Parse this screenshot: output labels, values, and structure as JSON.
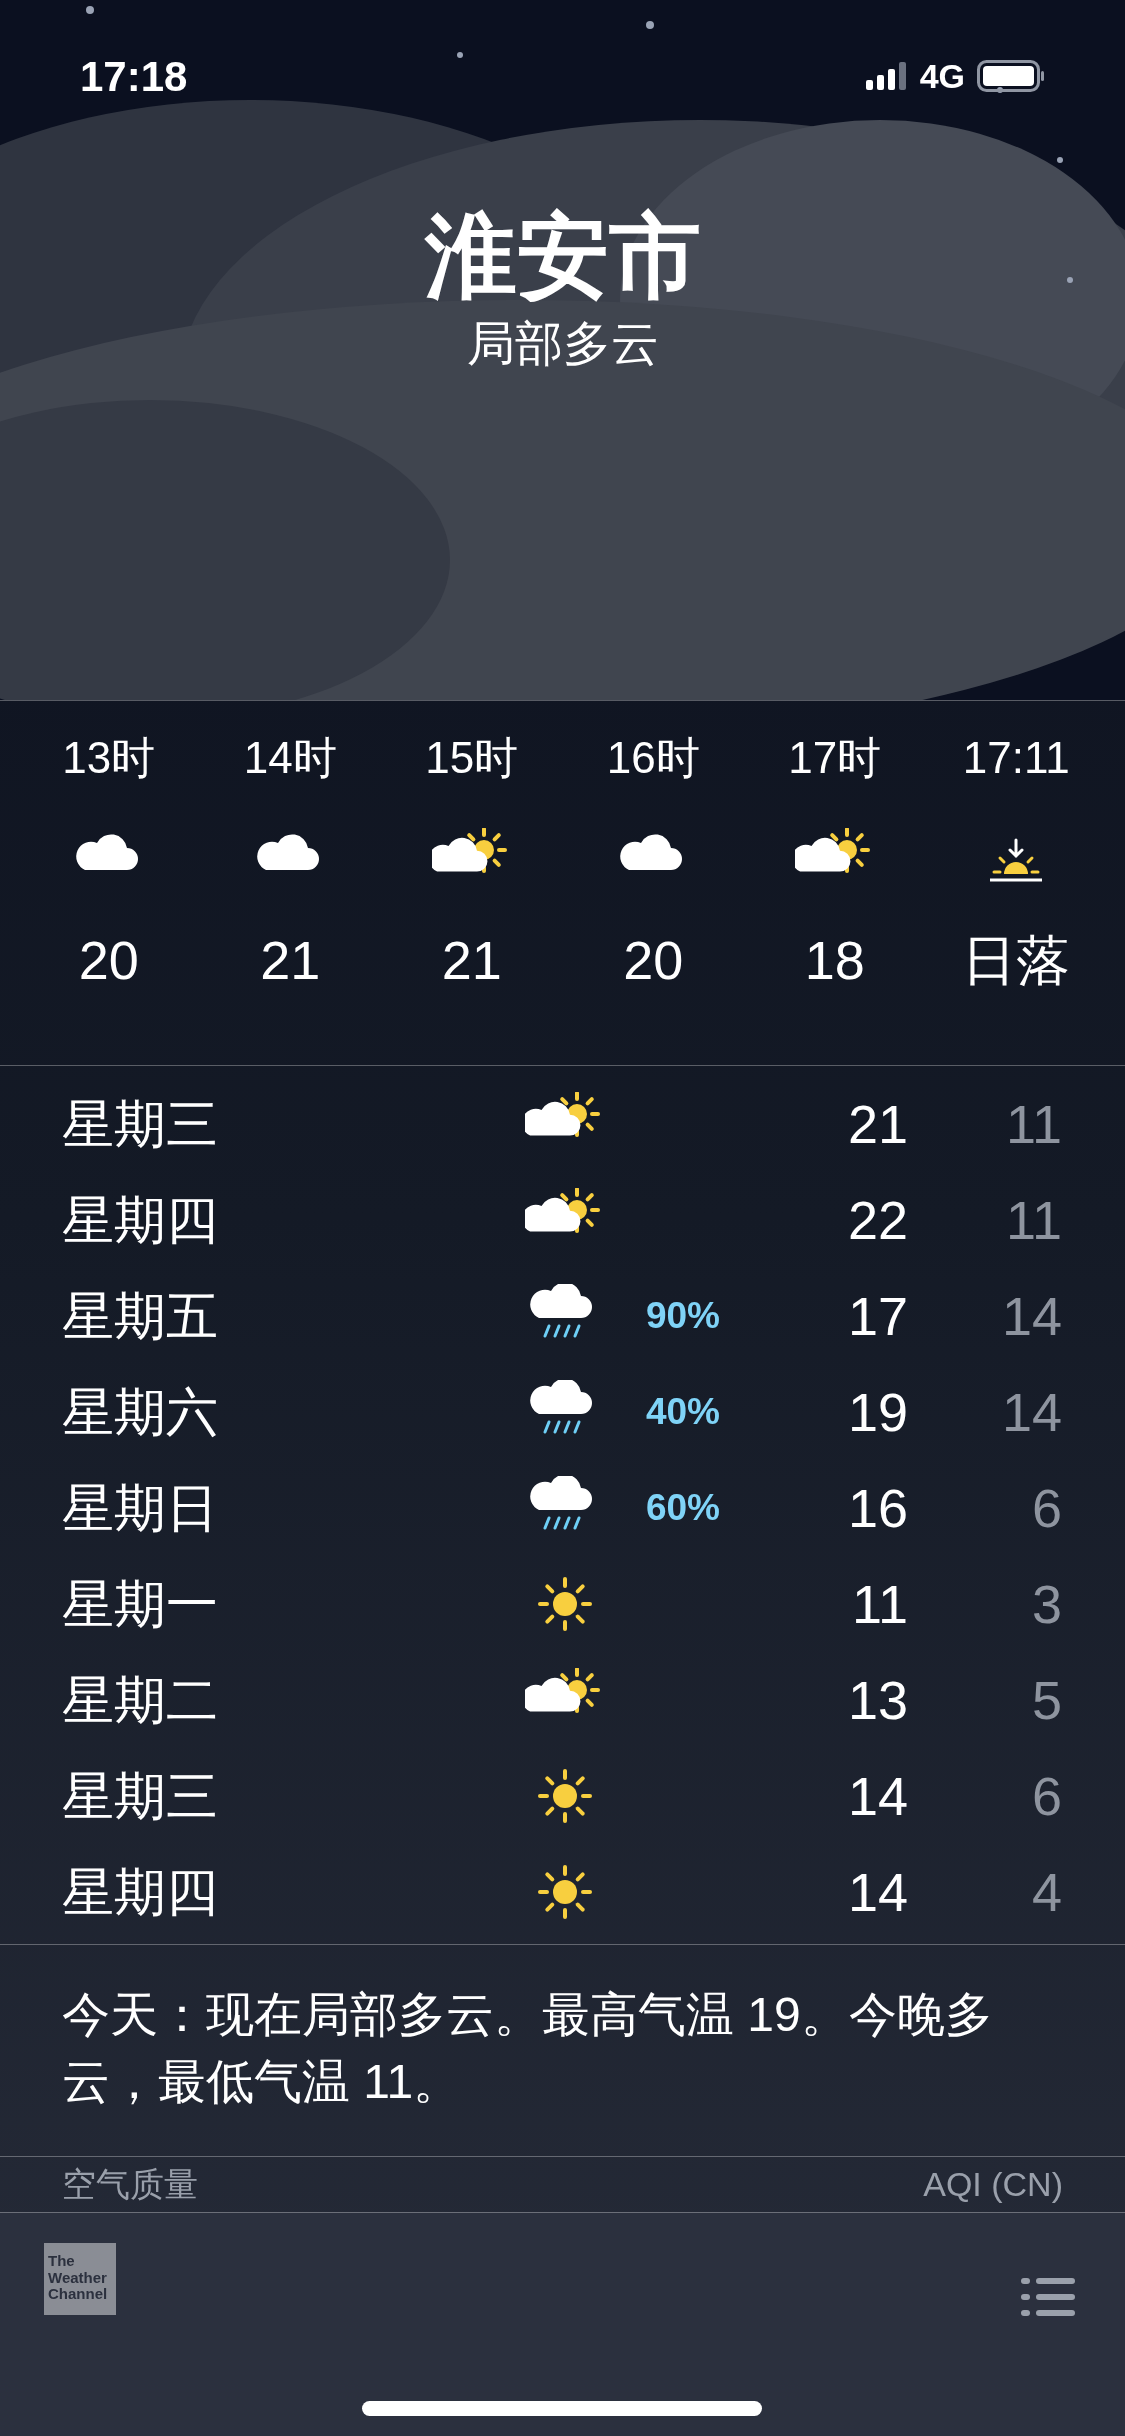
{
  "status_bar": {
    "time": "17:18",
    "network": "4G"
  },
  "header": {
    "city": "淮安市",
    "condition": "局部多云"
  },
  "hourly": [
    {
      "time": "13时",
      "kind": "cloud",
      "value": "20"
    },
    {
      "time": "14时",
      "kind": "cloud",
      "value": "21"
    },
    {
      "time": "15时",
      "kind": "partly-cloudy",
      "value": "21"
    },
    {
      "time": "16时",
      "kind": "cloud",
      "value": "20"
    },
    {
      "time": "17时",
      "kind": "partly-cloudy",
      "value": "18"
    },
    {
      "time": "17:11",
      "kind": "sunset",
      "value": "日落"
    }
  ],
  "daily": [
    {
      "day": "星期三",
      "kind": "partly-cloudy",
      "high": "21",
      "low": "11"
    },
    {
      "day": "星期四",
      "kind": "partly-cloudy",
      "high": "22",
      "low": "11"
    },
    {
      "day": "星期五",
      "kind": "rain",
      "chance": "90%",
      "high": "17",
      "low": "14"
    },
    {
      "day": "星期六",
      "kind": "rain",
      "chance": "40%",
      "high": "19",
      "low": "14"
    },
    {
      "day": "星期日",
      "kind": "rain",
      "chance": "60%",
      "high": "16",
      "low": "6"
    },
    {
      "day": "星期一",
      "kind": "sun",
      "high": "11",
      "low": "3"
    },
    {
      "day": "星期二",
      "kind": "partly-cloudy",
      "high": "13",
      "low": "5"
    },
    {
      "day": "星期三",
      "kind": "sun",
      "high": "14",
      "low": "6"
    },
    {
      "day": "星期四",
      "kind": "sun",
      "high": "14",
      "low": "4"
    }
  ],
  "summary": "今天：现在局部多云。最高气温 19。今晚多云，最低气温 11。",
  "air_quality": {
    "label": "空气质量",
    "scale": "AQI (CN)"
  },
  "toolbar": {
    "logo": "The Weather Channel"
  }
}
